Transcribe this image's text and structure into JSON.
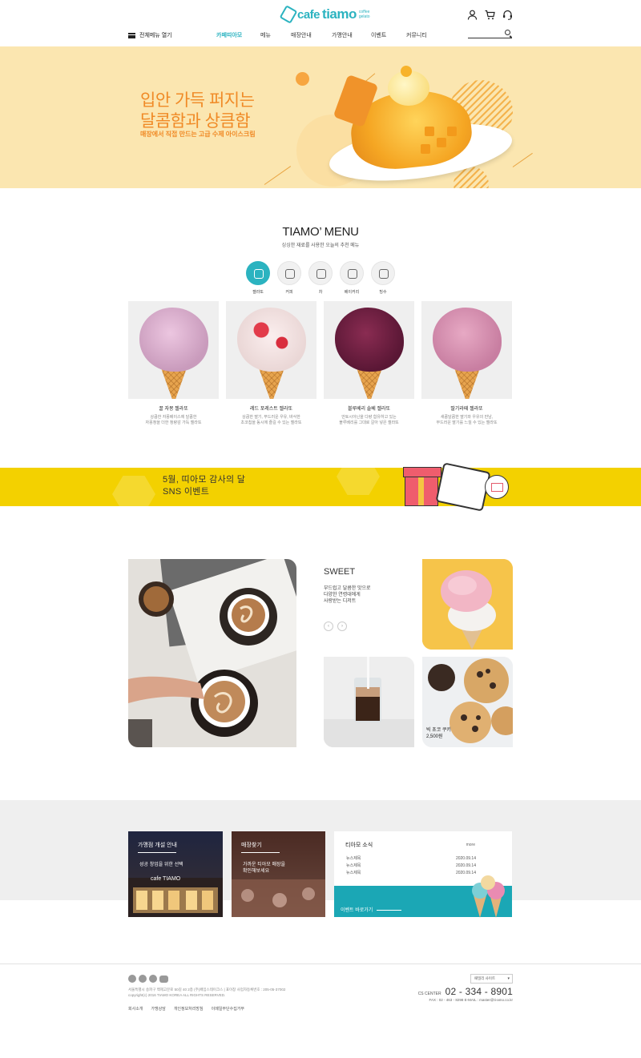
{
  "header": {
    "logo_cafe": "cafe",
    "logo_tiamo": "tiamo",
    "logo_sub": "coffee gelato",
    "all_menu": "전체메뉴 열기",
    "nav": [
      "카페띠아모",
      "메뉴",
      "매장안내",
      "가맹안내",
      "이벤트",
      "커뮤니티"
    ],
    "nav_active": 0,
    "icons": [
      "user-icon",
      "cart-icon",
      "headset-icon"
    ],
    "search_placeholder": ""
  },
  "hero": {
    "title_line1": "입안 가득 퍼지는",
    "title_line2": "달콤함과 상큼함",
    "subtitle": "매장에서 직접 만드는 고급 수제 아이스크림",
    "accent": "#f08a26",
    "bg": "#fbe6b0"
  },
  "menu": {
    "title": "TIAMO’ MENU",
    "subtitle": "싱싱한 재료를 사용한 오늘의 추천 메뉴",
    "categories": [
      "젤라또",
      "커피",
      "차",
      "베이커리",
      "빙수"
    ],
    "active_category": 0,
    "items": [
      {
        "name": "꿀 자몽 젤라또",
        "desc1": "상큼한 자몽베이스에 달콤한",
        "desc2": "자몽청을 더한 청량감 가득 젤라또",
        "color": "#d9a7c9"
      },
      {
        "name": "레드 포레스트 젤라또",
        "desc1": "상큼한 딸기, 부드러운 우유, 바삭한",
        "desc2": "초코칩을 동시에 즐길 수 있는 젤라또",
        "color": "#f1e7e6"
      },
      {
        "name": "블루베리 솔베 젤라또",
        "desc1": "안토시아닌을 다량 함유하고 있는",
        "desc2": "블루베리를 그대로 갈아 넣은 젤라또",
        "color": "#6b2140"
      },
      {
        "name": "딸기라떼 젤라또",
        "desc1": "새콤달콤한 딸기와 우유의 만남,",
        "desc2": "부드러운 딸기를 느낄 수 있는 젤라또",
        "color": "#d58fb0"
      }
    ]
  },
  "banner": {
    "line1": "5월, 띠아모 감사의 달",
    "line2": "SNS 이벤트",
    "bg": "#f3d100"
  },
  "sweet": {
    "title": "SWEET",
    "desc1": "부드럽고 달콤한 맛으로",
    "desc2": "다양한 연령대에게",
    "desc3": "사랑받는 디저트",
    "prev": "‹",
    "next": "›",
    "cookie_name": "빅 초코 쿠키",
    "cookie_price": "2,500원"
  },
  "info": {
    "box1_title": "가맹점 개설 안내",
    "box1_desc": "성공 창업을 위한 선택",
    "box1_sign": "cafe TIAMO",
    "box2_title": "매장찾기",
    "box2_desc1": "가까운 티아모 매장을",
    "box2_desc2": "확인해보세요",
    "news_title": "티아모 소식",
    "news_more": "more",
    "news": [
      {
        "title": "뉴스제목",
        "date": "2020.09.14"
      },
      {
        "title": "뉴스제목",
        "date": "2020.09.14"
      },
      {
        "title": "뉴스제목",
        "date": "2020.09.14"
      }
    ],
    "event_label": "이벤트 바로가기",
    "event_color": "#1ba7b5"
  },
  "footer": {
    "social": [
      "facebook-icon",
      "instagram-icon",
      "naver-blog-icon",
      "youtube-icon"
    ],
    "info_line1": "서울특별시 송파구 백제고분로 50길 40 2층 (주)페임스테이크스 | 표이창     사업자등록번호 : 205-05-37002",
    "info_line2": "copyright(c) 2016 TIAMO KOREA ALL RIGHTS RESERVED.",
    "links": [
      "회사소개",
      "가맹상담",
      "개인정보처리방침",
      "이메일무단수집거부"
    ],
    "family_site": "패밀리 사이트",
    "cs_label": "CS CENTER",
    "cs_number": "02 - 334 - 8901",
    "fax": "FAX : 02 - 463 - 8298     E-MAIL : master@ti-amo.co.kr"
  }
}
